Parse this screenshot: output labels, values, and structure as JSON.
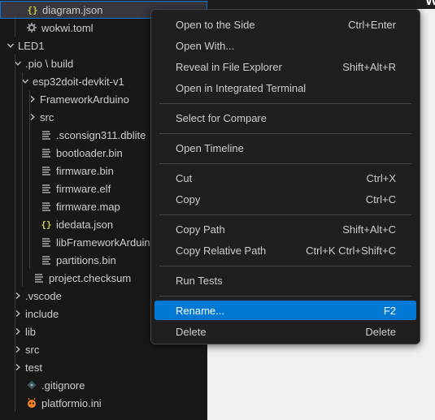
{
  "editor": {
    "title": "WOKWI  Diagram Editor"
  },
  "tree": [
    {
      "label": "diagram.json",
      "icon": "json-braces-icon",
      "depth": 1,
      "chevron": "none",
      "selected": true
    },
    {
      "label": "wokwi.toml",
      "icon": "gear-icon",
      "depth": 1,
      "chevron": "none"
    },
    {
      "label": "LED1",
      "icon": "",
      "depth": 0,
      "chevron": "down"
    },
    {
      "label": ".pio \\ build",
      "icon": "",
      "depth": 1,
      "chevron": "down"
    },
    {
      "label": "esp32doit-devkit-v1",
      "icon": "",
      "depth": 2,
      "chevron": "down"
    },
    {
      "label": "FrameworkArduino",
      "icon": "",
      "depth": 3,
      "chevron": "right"
    },
    {
      "label": "src",
      "icon": "",
      "depth": 3,
      "chevron": "right"
    },
    {
      "label": ".sconsign311.dblite",
      "icon": "lines-icon",
      "depth": 3,
      "chevron": "none"
    },
    {
      "label": "bootloader.bin",
      "icon": "lines-icon",
      "depth": 3,
      "chevron": "none"
    },
    {
      "label": "firmware.bin",
      "icon": "lines-icon",
      "depth": 3,
      "chevron": "none"
    },
    {
      "label": "firmware.elf",
      "icon": "lines-icon",
      "depth": 3,
      "chevron": "none"
    },
    {
      "label": "firmware.map",
      "icon": "lines-icon",
      "depth": 3,
      "chevron": "none"
    },
    {
      "label": "idedata.json",
      "icon": "json-braces-icon",
      "depth": 3,
      "chevron": "none"
    },
    {
      "label": "libFrameworkArduino.a",
      "icon": "lines-icon",
      "depth": 3,
      "chevron": "none"
    },
    {
      "label": "partitions.bin",
      "icon": "lines-icon",
      "depth": 3,
      "chevron": "none"
    },
    {
      "label": "project.checksum",
      "icon": "lines-icon",
      "depth": 2,
      "chevron": "none"
    },
    {
      "label": ".vscode",
      "icon": "",
      "depth": 1,
      "chevron": "right"
    },
    {
      "label": "include",
      "icon": "",
      "depth": 1,
      "chevron": "right"
    },
    {
      "label": "lib",
      "icon": "",
      "depth": 1,
      "chevron": "right"
    },
    {
      "label": "src",
      "icon": "",
      "depth": 1,
      "chevron": "right"
    },
    {
      "label": "test",
      "icon": "",
      "depth": 1,
      "chevron": "right"
    },
    {
      "label": ".gitignore",
      "icon": "git-icon",
      "depth": 1,
      "chevron": "none"
    },
    {
      "label": "platformio.ini",
      "icon": "platformio-ant-icon",
      "depth": 1,
      "chevron": "none"
    }
  ],
  "menu": {
    "groups": [
      [
        {
          "label": "Open to the Side",
          "shortcut": "Ctrl+Enter"
        },
        {
          "label": "Open With...",
          "shortcut": ""
        },
        {
          "label": "Reveal in File Explorer",
          "shortcut": "Shift+Alt+R"
        },
        {
          "label": "Open in Integrated Terminal",
          "shortcut": ""
        }
      ],
      [
        {
          "label": "Select for Compare",
          "shortcut": ""
        }
      ],
      [
        {
          "label": "Open Timeline",
          "shortcut": ""
        }
      ],
      [
        {
          "label": "Cut",
          "shortcut": "Ctrl+X"
        },
        {
          "label": "Copy",
          "shortcut": "Ctrl+C"
        }
      ],
      [
        {
          "label": "Copy Path",
          "shortcut": "Shift+Alt+C"
        },
        {
          "label": "Copy Relative Path",
          "shortcut": "Ctrl+K Ctrl+Shift+C"
        }
      ],
      [
        {
          "label": "Run Tests",
          "shortcut": ""
        }
      ],
      [
        {
          "label": "Rename...",
          "shortcut": "F2",
          "active": true
        },
        {
          "label": "Delete",
          "shortcut": "Delete"
        }
      ]
    ]
  },
  "colors": {
    "accent": "#0078d4",
    "json_icon": "#cbcb41",
    "ant_icon": "#f5822a"
  }
}
